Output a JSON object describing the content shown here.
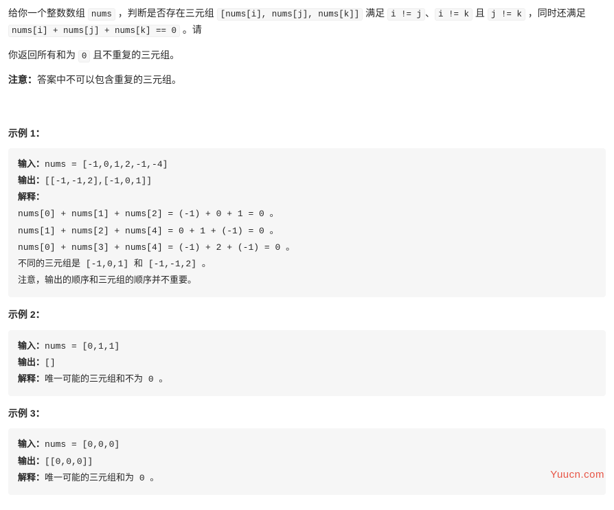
{
  "intro": {
    "line1_pre": "给你一个整数数组 ",
    "nums_code": "nums",
    "line1_mid1": " ，判断是否存在三元组 ",
    "triplet_code": "[nums[i], nums[j], nums[k]]",
    "line1_mid2": " 满足 ",
    "cond1_code": "i != j",
    "sep1": "、",
    "cond2_code": "i != k",
    "sep2": " 且 ",
    "cond3_code": "j != k",
    "line1_mid3": " ，同时还满足 ",
    "sum_code": "nums[i] + nums[j] + nums[k] == 0",
    "line1_end": " 。请",
    "line2_pre": "你返回所有和为 ",
    "zero_code": "0",
    "line2_end": " 且不重复的三元组。",
    "note_label": "注意：",
    "note_text": "答案中不可以包含重复的三元组。"
  },
  "labels": {
    "input": "输入：",
    "output": "输出：",
    "explain": "解释："
  },
  "examples": [
    {
      "heading": "示例 1：",
      "input_value": "nums = [-1,0,1,2,-1,-4]",
      "output_value": "[[-1,-1,2],[-1,0,1]]",
      "explain_lines": [
        "nums[0] + nums[1] + nums[2] = (-1) + 0 + 1 = 0 。",
        "nums[1] + nums[2] + nums[4] = 0 + 1 + (-1) = 0 。",
        "nums[0] + nums[3] + nums[4] = (-1) + 2 + (-1) = 0 。",
        "不同的三元组是 [-1,0,1] 和 [-1,-1,2] 。",
        "注意，输出的顺序和三元组的顺序并不重要。"
      ]
    },
    {
      "heading": "示例 2：",
      "input_value": "nums = [0,1,1]",
      "output_value": "[]",
      "explain_lines": [
        "唯一可能的三元组和不为 0 。"
      ]
    },
    {
      "heading": "示例 3：",
      "input_value": "nums = [0,0,0]",
      "output_value": "[[0,0,0]]",
      "explain_lines": [
        "唯一可能的三元组和为 0 。"
      ]
    }
  ],
  "watermark": "Yuucn.com"
}
